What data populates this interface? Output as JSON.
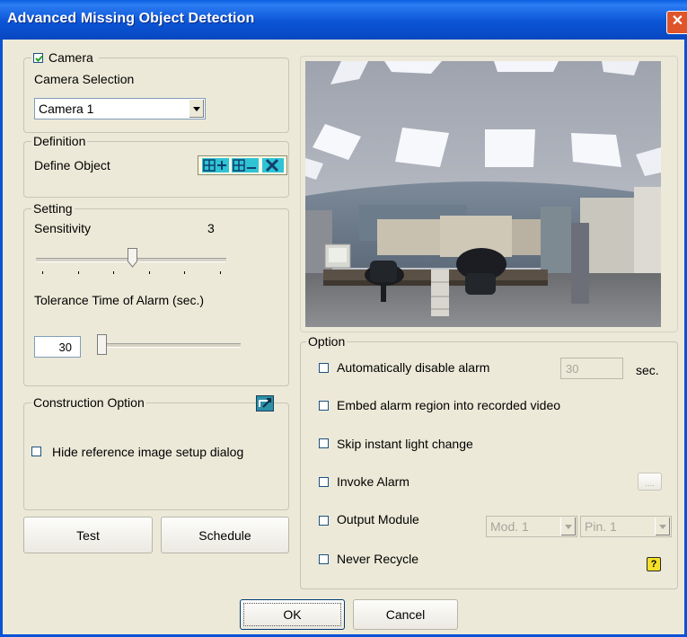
{
  "window": {
    "title": "Advanced Missing Object Detection",
    "close_glyph": "✕"
  },
  "camera": {
    "legend": "Camera",
    "checked": true,
    "selection_label": "Camera Selection",
    "selected": "Camera 1"
  },
  "definition": {
    "legend": "Definition",
    "define_label": "Define Object",
    "tools": [
      "add-region-icon",
      "remove-region-icon",
      "clear-region-icon"
    ]
  },
  "setting": {
    "legend": "Setting",
    "sensitivity_label": "Sensitivity",
    "sensitivity_value": "3",
    "sensitivity_level": 3,
    "sensitivity_max": 5,
    "tolerance_label": "Tolerance Time of Alarm (sec.)",
    "tolerance_value": "30",
    "tolerance_fraction": 0.0
  },
  "construction": {
    "legend": "Construction Option",
    "hide_label": "Hide reference image setup dialog",
    "hide_checked": false
  },
  "buttons": {
    "test": "Test",
    "schedule": "Schedule",
    "ok": "OK",
    "cancel": "Cancel"
  },
  "option": {
    "legend": "Option",
    "auto_disable_label": "Automatically disable alarm",
    "auto_disable_value": "30",
    "sec_label": "sec.",
    "embed_label": "Embed alarm region into recorded video",
    "skip_label": "Skip instant light change",
    "invoke_label": "Invoke Alarm",
    "browse_label": "....",
    "output_label": "Output Module",
    "module_selected": "Mod. 1",
    "pin_selected": "Pin. 1",
    "recycle_label": "Never Recycle",
    "help_glyph": "?"
  },
  "colors": {
    "titlebar": "#0a53d6",
    "dialog_bg": "#ece9d8",
    "tool_icon_bg": "#2fc3d6",
    "help_icon_bg": "#f4e02a"
  }
}
